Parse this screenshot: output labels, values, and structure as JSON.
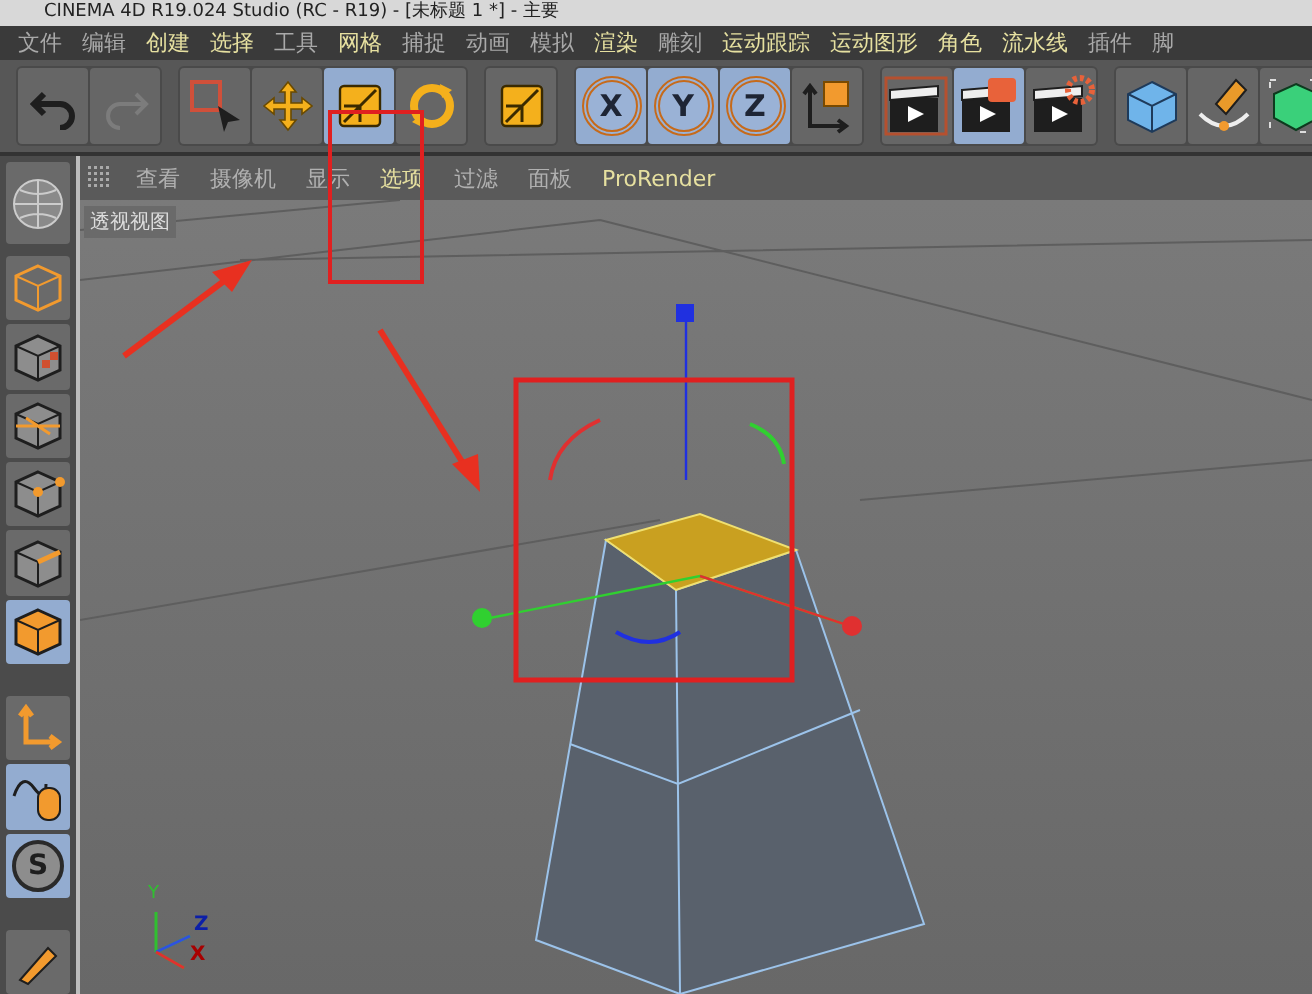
{
  "window": {
    "title": "CINEMA 4D R19.024 Studio (RC - R19) - [未标题 1 *] - 主要"
  },
  "menu": [
    {
      "label": "文件",
      "highlighted": false
    },
    {
      "label": "编辑",
      "highlighted": false
    },
    {
      "label": "创建",
      "highlighted": true
    },
    {
      "label": "选择",
      "highlighted": true
    },
    {
      "label": "工具",
      "highlighted": false
    },
    {
      "label": "网格",
      "highlighted": true
    },
    {
      "label": "捕捉",
      "highlighted": false
    },
    {
      "label": "动画",
      "highlighted": false
    },
    {
      "label": "模拟",
      "highlighted": false
    },
    {
      "label": "渲染",
      "highlighted": true
    },
    {
      "label": "雕刻",
      "highlighted": false
    },
    {
      "label": "运动跟踪",
      "highlighted": true
    },
    {
      "label": "运动图形",
      "highlighted": true
    },
    {
      "label": "角色",
      "highlighted": true
    },
    {
      "label": "流水线",
      "highlighted": true
    },
    {
      "label": "插件",
      "highlighted": false
    },
    {
      "label": "脚",
      "highlighted": false
    }
  ],
  "toolbar": [
    [
      {
        "kind": "undo",
        "selected": false
      },
      {
        "kind": "redo",
        "selected": false
      }
    ],
    [
      {
        "kind": "select",
        "selected": false
      },
      {
        "kind": "move",
        "selected": false
      },
      {
        "kind": "scale",
        "selected": true
      },
      {
        "kind": "rotate",
        "selected": false
      }
    ],
    [
      {
        "kind": "scale",
        "selected": false
      }
    ],
    [
      {
        "kind": "axis",
        "label": "X",
        "selected": true
      },
      {
        "kind": "axis",
        "label": "Y",
        "selected": true
      },
      {
        "kind": "axis",
        "label": "Z",
        "selected": true
      },
      {
        "kind": "coords",
        "selected": false
      }
    ],
    [
      {
        "kind": "render",
        "selected": false
      },
      {
        "kind": "render-region",
        "selected": true
      },
      {
        "kind": "render-settings",
        "selected": false
      }
    ],
    [
      {
        "kind": "cube",
        "selected": false
      },
      {
        "kind": "pen",
        "selected": false
      },
      {
        "kind": "green-cube",
        "selected": false
      }
    ]
  ],
  "palette": [
    {
      "kind": "sphere",
      "selected": false
    },
    {
      "kind": "model",
      "selected": false
    },
    {
      "kind": "texture",
      "selected": false
    },
    {
      "kind": "workplane",
      "selected": false
    },
    {
      "kind": "points",
      "selected": false
    },
    {
      "kind": "edges",
      "selected": false
    },
    {
      "kind": "polygons",
      "selected": true
    },
    {
      "kind": "gap"
    },
    {
      "kind": "axis",
      "selected": false
    },
    {
      "kind": "mouse",
      "selected": true
    },
    {
      "kind": "snap",
      "label": "S",
      "selected": true
    },
    {
      "kind": "gap"
    },
    {
      "kind": "brush",
      "selected": false
    }
  ],
  "view_menu": [
    {
      "label": "查看",
      "highlighted": false
    },
    {
      "label": "摄像机",
      "highlighted": false
    },
    {
      "label": "显示",
      "highlighted": false
    },
    {
      "label": "选项",
      "highlighted": true
    },
    {
      "label": "过滤",
      "highlighted": false
    },
    {
      "label": "面板",
      "highlighted": false
    },
    {
      "label": "ProRender",
      "highlighted": true
    }
  ],
  "viewport": {
    "label": "透视视图",
    "axis_labels": [
      "Y",
      "Z",
      "X"
    ]
  }
}
